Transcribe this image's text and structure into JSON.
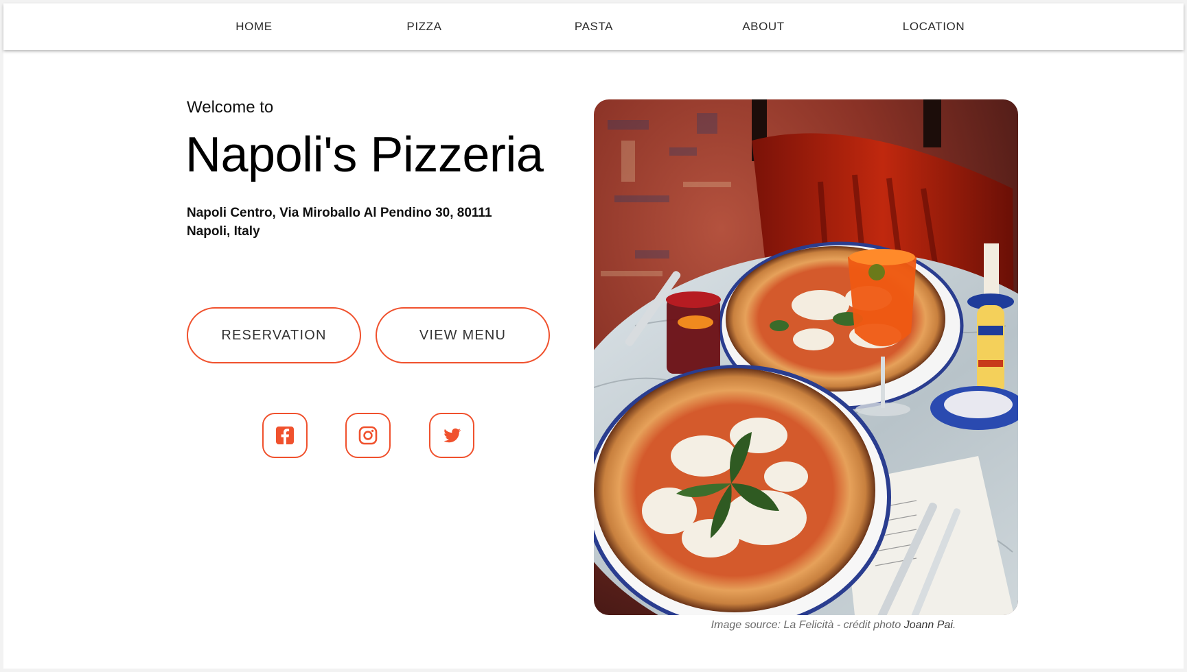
{
  "nav": {
    "items": [
      {
        "label": "HOME"
      },
      {
        "label": "PIZZA"
      },
      {
        "label": "PASTA"
      },
      {
        "label": "ABOUT"
      },
      {
        "label": "LOCATION"
      }
    ]
  },
  "hero": {
    "welcome": "Welcome to",
    "title": "Napoli's Pizzeria",
    "address": "Napoli Centro, Via Miroballo Al Pendino 30, 80111 Napoli, Italy",
    "buttons": {
      "reservation": "RESERVATION",
      "view_menu": "VIEW MENU"
    },
    "social": [
      "facebook-icon",
      "instagram-icon",
      "twitter-icon"
    ]
  },
  "photo": {
    "caption_prefix": "Image source: La Felicità - crédit photo ",
    "caption_credit": "Joann Pai",
    "caption_suffix": "."
  },
  "colors": {
    "accent": "#f0512d",
    "text": "#111111",
    "nav_text": "#2b2b2b"
  }
}
